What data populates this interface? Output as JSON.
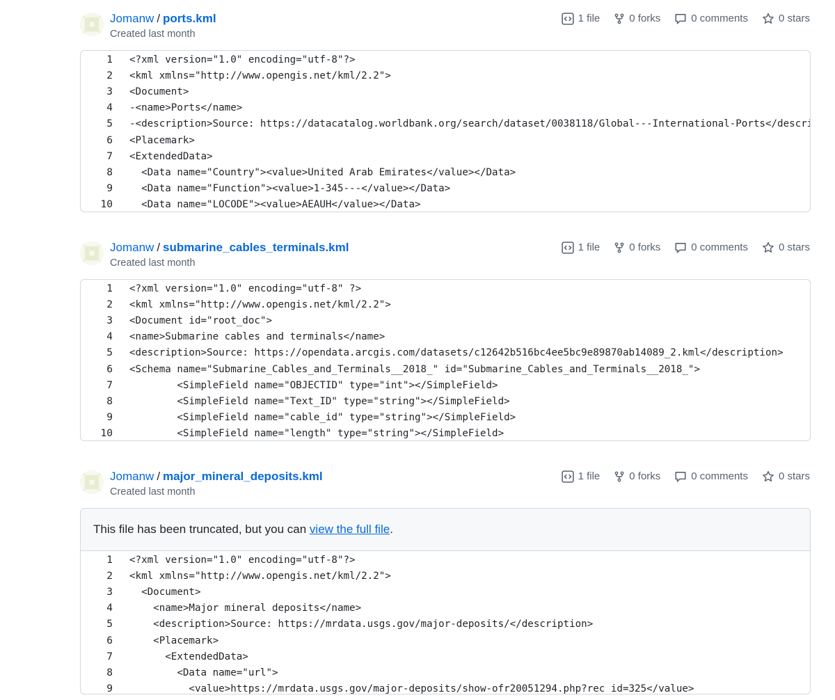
{
  "gists": [
    {
      "owner": "Jomanw",
      "separator": "/",
      "filename": "ports.kml",
      "created": "Created last month",
      "stats": {
        "files": "1 file",
        "forks": "0 forks",
        "comments": "0 comments",
        "stars": "0 stars"
      },
      "lines": [
        {
          "n": "1",
          "code": "<?xml version=\"1.0\" encoding=\"utf-8\"?>"
        },
        {
          "n": "2",
          "code": "<kml xmlns=\"http://www.opengis.net/kml/2.2\">"
        },
        {
          "n": "3",
          "code": "<Document>"
        },
        {
          "n": "4",
          "code": "-<name>Ports</name>"
        },
        {
          "n": "5",
          "code": "-<description>Source: https://datacatalog.worldbank.org/search/dataset/0038118/Global---International-Ports</description>"
        },
        {
          "n": "6",
          "code": "<Placemark>"
        },
        {
          "n": "7",
          "code": "<ExtendedData>"
        },
        {
          "n": "8",
          "code": "  <Data name=\"Country\"><value>United Arab Emirates</value></Data>"
        },
        {
          "n": "9",
          "code": "  <Data name=\"Function\"><value>1-345---</value></Data>"
        },
        {
          "n": "10",
          "code": "  <Data name=\"LOCODE\"><value>AEAUH</value></Data>"
        }
      ]
    },
    {
      "owner": "Jomanw",
      "separator": "/",
      "filename": "submarine_cables_terminals.kml",
      "created": "Created last month",
      "stats": {
        "files": "1 file",
        "forks": "0 forks",
        "comments": "0 comments",
        "stars": "0 stars"
      },
      "lines": [
        {
          "n": "1",
          "code": "<?xml version=\"1.0\" encoding=\"utf-8\" ?>"
        },
        {
          "n": "2",
          "code": "<kml xmlns=\"http://www.opengis.net/kml/2.2\">"
        },
        {
          "n": "3",
          "code": "<Document id=\"root_doc\">"
        },
        {
          "n": "4",
          "code": "<name>Submarine cables and terminals</name>"
        },
        {
          "n": "5",
          "code": "<description>Source: https://opendata.arcgis.com/datasets/c12642b516bc4ee5bc9e89870ab14089_2.kml</description>"
        },
        {
          "n": "6",
          "code": "<Schema name=\"Submarine_Cables_and_Terminals__2018_\" id=\"Submarine_Cables_and_Terminals__2018_\">"
        },
        {
          "n": "7",
          "code": "        <SimpleField name=\"OBJECTID\" type=\"int\"></SimpleField>"
        },
        {
          "n": "8",
          "code": "        <SimpleField name=\"Text_ID\" type=\"string\"></SimpleField>"
        },
        {
          "n": "9",
          "code": "        <SimpleField name=\"cable_id\" type=\"string\"></SimpleField>"
        },
        {
          "n": "10",
          "code": "        <SimpleField name=\"length\" type=\"string\"></SimpleField>"
        }
      ]
    },
    {
      "owner": "Jomanw",
      "separator": "/",
      "filename": "major_mineral_deposits.kml",
      "created": "Created last month",
      "stats": {
        "files": "1 file",
        "forks": "0 forks",
        "comments": "0 comments",
        "stars": "0 stars"
      },
      "truncated": {
        "prefix": "This file has been truncated, but you can ",
        "link": "view the full file",
        "suffix": "."
      },
      "lines": [
        {
          "n": "1",
          "code": "<?xml version=\"1.0\" encoding=\"utf-8\"?>"
        },
        {
          "n": "2",
          "code": "<kml xmlns=\"http://www.opengis.net/kml/2.2\">"
        },
        {
          "n": "3",
          "code": "  <Document>"
        },
        {
          "n": "4",
          "code": "    <name>Major mineral deposits</name>"
        },
        {
          "n": "5",
          "code": "    <description>Source: https://mrdata.usgs.gov/major-deposits/</description>"
        },
        {
          "n": "6",
          "code": "    <Placemark>"
        },
        {
          "n": "7",
          "code": "      <ExtendedData>"
        },
        {
          "n": "8",
          "code": "        <Data name=\"url\">"
        },
        {
          "n": "9",
          "code": "          <value>https://mrdata.usgs.gov/major-deposits/show-ofr20051294.php?rec_id=325</value>"
        }
      ]
    }
  ]
}
